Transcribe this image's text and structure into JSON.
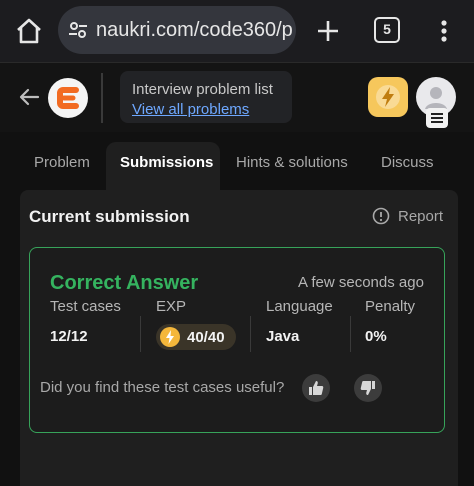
{
  "browser": {
    "url": "naukri.com/code360/p",
    "tab_count": "5",
    "icons": {
      "home": "home-icon",
      "site_info": "tune-icon",
      "new_tab": "plus-icon",
      "menu": "more-vert-icon"
    }
  },
  "header": {
    "problem_list_title": "Interview problem list",
    "view_all_link": "View all problems",
    "icons": {
      "back": "arrow-left-icon",
      "logo": "code360-logo",
      "streak": "bolt-icon",
      "profile": "avatar-icon"
    }
  },
  "tabs": [
    {
      "label": "Problem",
      "active": false
    },
    {
      "label": "Submissions",
      "active": true
    },
    {
      "label": "Hints & solutions",
      "active": false
    },
    {
      "label": "Discuss",
      "active": false
    }
  ],
  "submission": {
    "title": "Current submission",
    "report_label": "Report",
    "status": "Correct Answer",
    "time": "A few seconds ago",
    "test_cases_label": "Test cases",
    "test_cases_value": "12/12",
    "exp_label": "EXP",
    "exp_value": "40/40",
    "language_label": "Language",
    "language_value": "Java",
    "penalty_label": "Penalty",
    "penalty_value": "0%",
    "feedback_question": "Did you find these test cases useful?"
  },
  "colors": {
    "success": "#35b35f",
    "link": "#6ea8ff",
    "accent": "#f6c75c"
  }
}
